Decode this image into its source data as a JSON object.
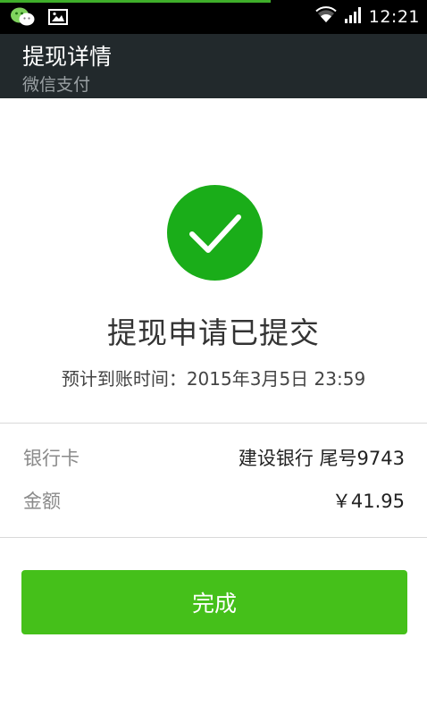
{
  "status_bar": {
    "time": "12:21",
    "icons": [
      "wechat-icon",
      "image-icon",
      "wifi-icon",
      "signal-icon"
    ]
  },
  "header": {
    "title": "提现详情",
    "subtitle": "微信支付"
  },
  "result": {
    "icon": "check-circle-icon",
    "title": "提现申请已提交",
    "arrival_label": "预计到账时间：",
    "arrival_value": "2015年3月5日 23:59"
  },
  "details": [
    {
      "label": "银行卡",
      "value": "建设银行 尾号9743"
    },
    {
      "label": "金额",
      "value": "￥41.95"
    }
  ],
  "done_button": {
    "label": "完成"
  },
  "colors": {
    "accent": "#45c01a",
    "success": "#1aad19",
    "header_bg": "#22292c"
  }
}
